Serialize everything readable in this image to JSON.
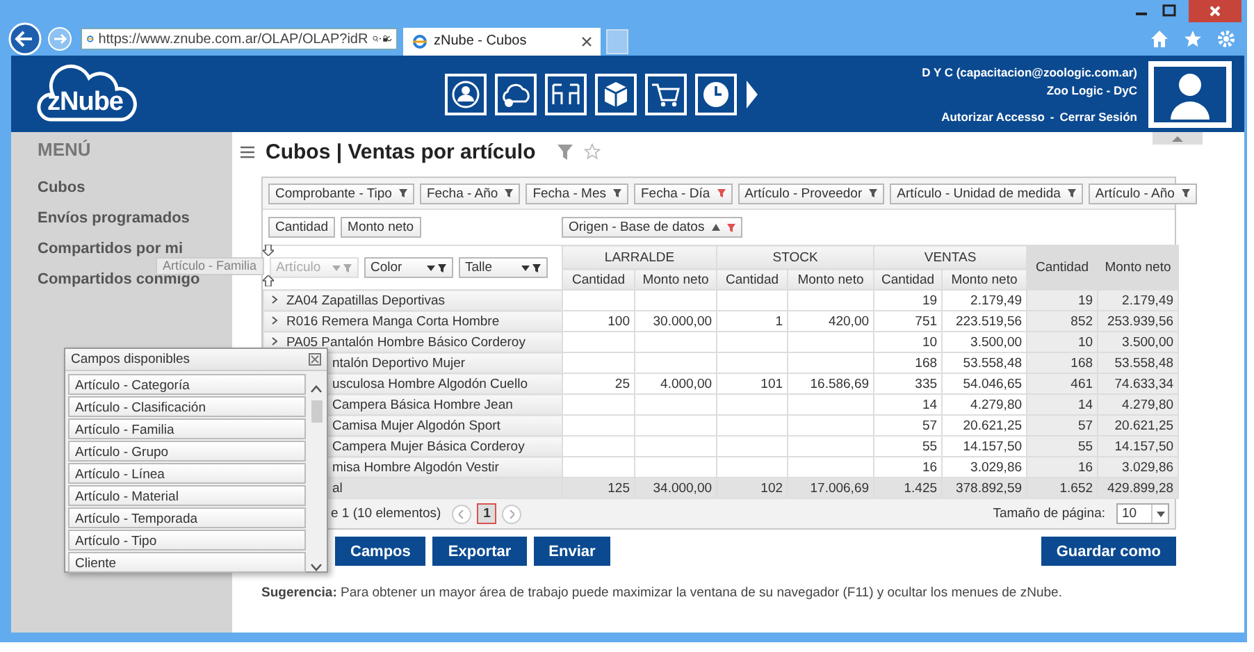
{
  "browser": {
    "address": "https://www.znube.com.ar/OLAP/OLAP?idR",
    "tab_title": "zNube - Cubos"
  },
  "header": {
    "logo": "zNube",
    "user": "D Y C (capacitacion@zoologic.com.ar)",
    "company": "Zoo Logic - DyC",
    "links": [
      "Autorizar Accesso",
      "Cerrar Sesión"
    ],
    "separator": "-"
  },
  "sidebar": {
    "title": "MENÚ",
    "items": [
      "Cubos",
      "Envíos programados",
      "Compartidos por mi",
      "Compartidos conmigo"
    ]
  },
  "page_title": "Cubos | Ventas por artículo",
  "filter_fields": [
    {
      "label": "Comprobante - Tipo",
      "filtered": false
    },
    {
      "label": "Fecha - Año",
      "filtered": false
    },
    {
      "label": "Fecha - Mes",
      "filtered": false
    },
    {
      "label": "Fecha - Día",
      "filtered": true
    },
    {
      "label": "Artículo - Proveedor",
      "filtered": false
    },
    {
      "label": "Artículo - Unidad de medida",
      "filtered": false
    },
    {
      "label": "Artículo - Año",
      "filtered": false
    }
  ],
  "data_fields": [
    "Cantidad",
    "Monto neto"
  ],
  "column_field": {
    "label": "Origen - Base de datos",
    "filtered": true
  },
  "row_fields": [
    {
      "label": "Artículo",
      "disabled": true
    },
    {
      "label": "Color",
      "disabled": false
    },
    {
      "label": "Talle",
      "disabled": false
    }
  ],
  "drag_ghost": "Artículo - Familia",
  "column_groups": [
    "LARRALDE",
    "STOCK",
    "VENTAS"
  ],
  "sub_headers": [
    "Cantidad",
    "Monto neto",
    "Cantidad",
    "Monto neto",
    "Cantidad",
    "Monto neto"
  ],
  "total_headers": [
    "Cantidad",
    "Monto neto"
  ],
  "rows": [
    {
      "label": "ZA04 Zapatillas Deportivas",
      "kind": "full",
      "cells": [
        null,
        null,
        null,
        null,
        "19",
        "2.179,49",
        "19",
        "2.179,49"
      ]
    },
    {
      "label": "R016 Remera Manga Corta Hombre",
      "kind": "full",
      "cells": [
        "100",
        "30.000,00",
        "1",
        "420,00",
        "751",
        "223.519,56",
        "852",
        "253.939,56"
      ]
    },
    {
      "label": "PA05 Pantalón Hombre Básico Corderoy",
      "kind": "full",
      "cells": [
        null,
        null,
        null,
        null,
        "10",
        "3.500,00",
        "10",
        "3.500,00"
      ]
    },
    {
      "label": "ntalón Deportivo Mujer",
      "kind": "covered",
      "cells": [
        null,
        null,
        null,
        null,
        "168",
        "53.558,48",
        "168",
        "53.558,48"
      ]
    },
    {
      "label": "usculosa Hombre Algodón Cuello",
      "kind": "covered",
      "cells": [
        "25",
        "4.000,00",
        "101",
        "16.586,69",
        "335",
        "54.046,65",
        "461",
        "74.633,34"
      ]
    },
    {
      "label": "Campera Básica Hombre Jean",
      "kind": "covered",
      "cells": [
        null,
        null,
        null,
        null,
        "14",
        "4.279,80",
        "14",
        "4.279,80"
      ]
    },
    {
      "label": "Camisa Mujer Algodón Sport",
      "kind": "covered",
      "cells": [
        null,
        null,
        null,
        null,
        "57",
        "20.621,25",
        "57",
        "20.621,25"
      ]
    },
    {
      "label": "Campera Mujer Básica Corderoy",
      "kind": "covered",
      "cells": [
        null,
        null,
        null,
        null,
        "55",
        "14.157,50",
        "55",
        "14.157,50"
      ]
    },
    {
      "label": "misa Hombre Algodón Vestir",
      "kind": "covered",
      "cells": [
        null,
        null,
        null,
        null,
        "16",
        "3.029,86",
        "16",
        "3.029,86"
      ]
    }
  ],
  "total_row": {
    "label": "al",
    "cells": [
      "125",
      "34.000,00",
      "102",
      "17.006,69",
      "1.425",
      "378.892,59",
      "1.652",
      "429.899,28"
    ]
  },
  "pager": {
    "summary": "e 1 (10 elementos)",
    "pages": [
      {
        "label": "1",
        "selected": true
      }
    ],
    "page_size_label": "Tamaño de página:",
    "page_size": "10"
  },
  "buttons": [
    "Campos",
    "Exportar",
    "Enviar"
  ],
  "save_button": "Guardar como",
  "hint": "**Sugerencia:** Para obtener un mayor área de trabajo puede maximizar la ventana de su navegador (F11) y ocultar los menues de zNube.",
  "popup": {
    "title": "Campos disponibles",
    "items": [
      "Artículo - Categoría",
      "Artículo - Clasificación",
      "Artículo - Familia",
      "Artículo - Grupo",
      "Artículo - Línea",
      "Artículo - Material",
      "Artículo - Temporada",
      "Artículo - Tipo",
      "Cliente"
    ]
  }
}
